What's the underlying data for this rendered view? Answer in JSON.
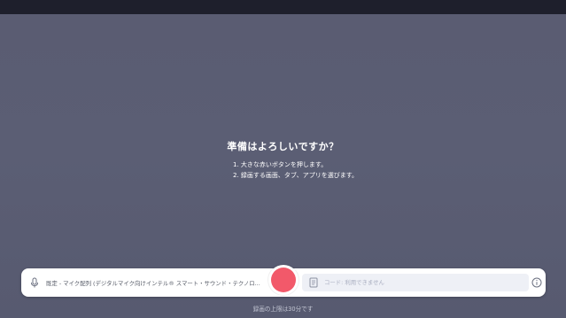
{
  "prompt": {
    "title": "準備はよろしいですか？",
    "steps": [
      "1. 大きな赤いボタンを押します。",
      "2. 録画する画面、タブ、アプリを選びます。"
    ]
  },
  "controls": {
    "mic_label": "既定 - マイク配列 (デジタルマイク向けインテル® スマート・サウンド・テクノロ...",
    "code_placeholder": "コード: 利用できません",
    "record_color": "#f2596a",
    "icons": {
      "mic": "microphone-icon",
      "code": "document-icon",
      "info": "info-icon"
    }
  },
  "footer": {
    "limit_note": "録画の上限は30分です"
  }
}
